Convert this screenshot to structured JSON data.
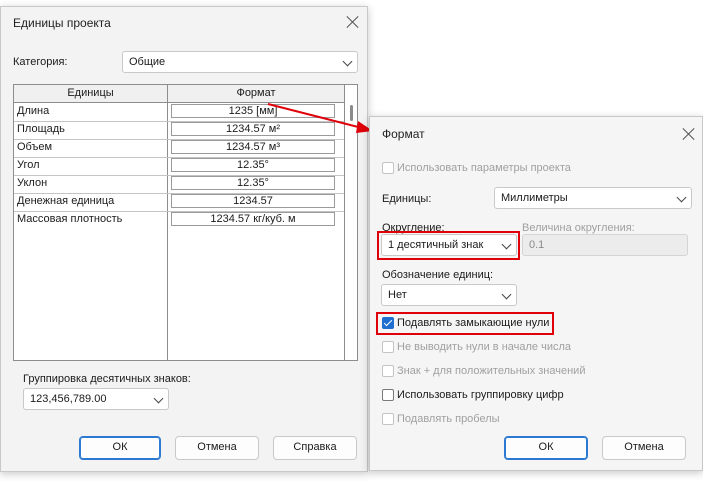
{
  "units_dialog": {
    "title": "Единицы проекта",
    "category_label": "Категория:",
    "category_value": "Общие",
    "columns": [
      "Единицы",
      "Формат"
    ],
    "rows": [
      {
        "name": "Длина",
        "format": "1235 [мм]"
      },
      {
        "name": "Площадь",
        "format": "1234.57 м²"
      },
      {
        "name": "Объем",
        "format": "1234.57 м³"
      },
      {
        "name": "Угол",
        "format": "12.35°"
      },
      {
        "name": "Уклон",
        "format": "12.35°"
      },
      {
        "name": "Денежная единица",
        "format": "1234.57"
      },
      {
        "name": "Массовая плотность",
        "format": "1234.57 кг/куб. м"
      }
    ],
    "grouping_label": "Группировка десятичных знаков:",
    "grouping_value": "123,456,789.00",
    "ok": "ОК",
    "cancel": "Отмена",
    "help": "Справка"
  },
  "format_dialog": {
    "title": "Формат",
    "use_project_settings": "Использовать параметры проекта",
    "units_label": "Единицы:",
    "units_value": "Миллиметры",
    "rounding_label": "Округление:",
    "rounding_value": "1 десятичный знак",
    "rounding_increment_label": "Величина округления:",
    "rounding_increment_value": "0.1",
    "unit_symbol_label": "Обозначение единиц:",
    "unit_symbol_value": "Нет",
    "suppress_trailing_zeros": "Подавлять замыкающие нули",
    "suppress_leading_zeros": "Не выводить нули в начале числа",
    "plus_prefix": "Знак + для положительных значений",
    "digit_grouping": "Использовать группировку цифр",
    "suppress_spaces": "Подавлять пробелы",
    "ok": "ОК",
    "cancel": "Отмена"
  },
  "colors": {
    "highlight": "#e0000a",
    "accent": "#1f6fd0"
  }
}
